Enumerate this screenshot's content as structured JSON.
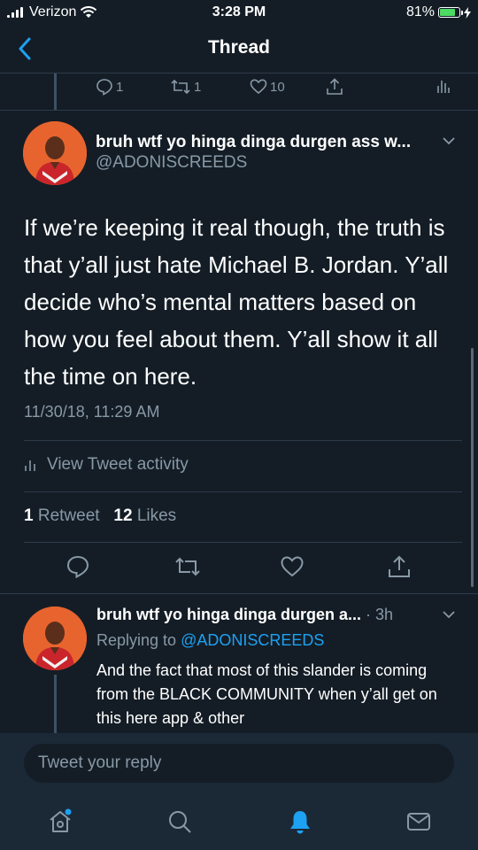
{
  "status_bar": {
    "carrier": "Verizon",
    "time": "3:28 PM",
    "battery": "81%",
    "battery_level": 0.81
  },
  "header": {
    "title": "Thread",
    "back_icon": "chevron-left-icon"
  },
  "previous_tweet": {
    "reply_count": "1",
    "retweet_count": "1",
    "like_count": "10"
  },
  "main_tweet": {
    "display_name": "bruh wtf yo hinga dinga durgen ass w...",
    "handle": "@ADONISCREEDS",
    "text": "If we’re keeping it real though, the truth is that y’all just hate Michael B. Jordan. Y’all decide who’s mental matters based on how you feel about them. Y’all show it all the time on here.",
    "timestamp": "11/30/18, 11:29 AM",
    "activity_label": "View Tweet activity",
    "retweets_count": "1",
    "retweets_label": "Retweet",
    "likes_count": "12",
    "likes_label": "Likes"
  },
  "reply_tweet": {
    "display_name": "bruh wtf yo hinga dinga durgen a...",
    "time": "· 3h",
    "replying_label": "Replying to",
    "replying_handle": "@ADONISCREEDS",
    "text": "And the fact that most of this slander is coming from the BLACK COMMUNITY when y’all get on this here app & other"
  },
  "composer": {
    "placeholder": "Tweet your reply"
  },
  "tabbar": {
    "items": [
      "home-icon",
      "search-icon",
      "notifications-icon",
      "messages-icon"
    ],
    "active": "notifications-icon"
  },
  "colors": {
    "background": "#141d26",
    "accent": "#1da1f2",
    "muted": "#8899a6",
    "divider": "#2c3a48"
  }
}
